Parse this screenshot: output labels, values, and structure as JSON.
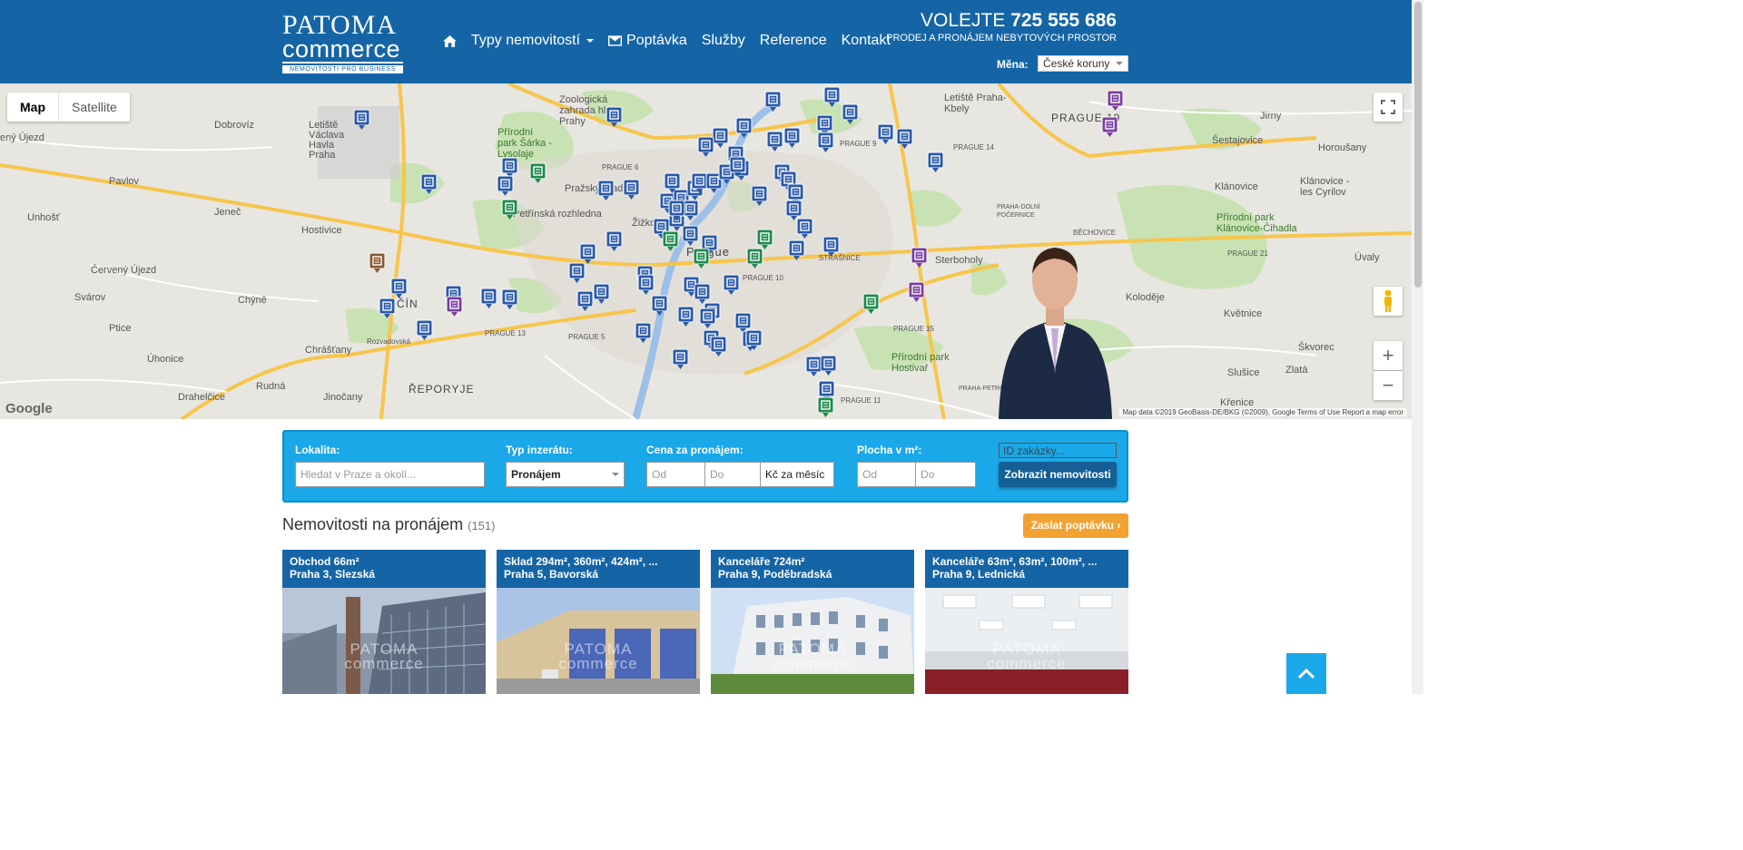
{
  "header": {
    "logo": {
      "top": "PATOMA",
      "bottom": "commerce",
      "sub": "NEMOVITOSTI PRO BUSINESS"
    },
    "nav": {
      "types": "Typy nemovitostí",
      "inquiry": "Poptávka",
      "services": "Služby",
      "references": "Reference",
      "contact": "Kontakt"
    },
    "call_prefix": "VOLEJTE",
    "phone": "725 555 686",
    "tagline": "PRODEJ A PRONÁJEM NEBYTOVÝCH PROSTOR",
    "currency_label": "Měna:",
    "currency_value": "České koruny"
  },
  "map": {
    "type_map": "Map",
    "type_satellite": "Satellite",
    "google": "Google",
    "credits": "Map data ©2019 GeoBasis-DE/BKG (©2009), Google    Terms of Use    Report a map error",
    "labels": [
      "Zoologická zahrada hl. m. Prahy",
      "Letiště Praha-Kbely",
      "PRAGUE 19",
      "Jirny",
      "Dobrovíz",
      "Letiště Václava Havla Praha",
      "Přírodní park Šárka - Lysolaje",
      "PRAGUE 6",
      "PRAGUE 9",
      "PRAGUE 14",
      "Šestajovice",
      "Horoušany",
      "Pavlov",
      "Jeneč",
      "Pražský hrad",
      "Petřínská rozhledna",
      "Žižkov",
      "Klánovice",
      "Klánovice - les Cyrilov",
      "Unhošť",
      "Hostivice",
      "Prague",
      "STRAŠNICE",
      "Přírodní park Klánovice-Čihadla",
      "Červený Újezd",
      "PRAHA-DOLNÍ POČERNICE",
      "BĚCHOVICE",
      "PRAGUE 21",
      "Úvaly",
      "Svárov",
      "Chýně",
      "PRAGUE 10",
      "Sterboholy",
      "Koloděje",
      "Ptice",
      "PRAGUE 13",
      "PRAGUE 5",
      "PRAGUE 15",
      "Květnice",
      "Chrášťany",
      "Úhonice",
      "Přírodní park Hostivař",
      "Škvorec",
      "Slušice",
      "Zlatá",
      "Rudná",
      "ŘEPORYJE",
      "PRAGUE 11",
      "PRAHA-PETROVICE",
      "Křenice",
      "Drahelčice",
      "Jinočany",
      "ený Újezd",
      "Rozvadovská",
      "ČÍN"
    ]
  },
  "search": {
    "location_label": "Lokalita:",
    "location_placeholder": "Hledat v Praze a okolí...",
    "type_label": "Typ inzerátu:",
    "type_value": "Pronájem",
    "price_label": "Cena za pronájem:",
    "price_from": "Od",
    "price_to": "Do",
    "price_unit": "Kč za měsíc",
    "area_label": "Plocha v m²:",
    "area_from": "Od",
    "area_to": "Do",
    "id_placeholder": "ID zakázky...",
    "submit": "Zobrazit nemovitosti"
  },
  "listing": {
    "title": "Nemovitosti na pronájem",
    "count": "(151)",
    "inquiry_button": "Zaslat poptávku",
    "cards": [
      {
        "title": "Obchod 66m²",
        "location": "Praha 3, Slezská",
        "watermark_top": "PATOMA",
        "watermark_bottom": "commerce"
      },
      {
        "title": "Sklad 294m², 360m², 424m², ...",
        "location": "Praha 5, Bavorská",
        "watermark_top": "PATOMA",
        "watermark_bottom": "commerce"
      },
      {
        "title": "Kanceláře 724m²",
        "location": "Praha 9, Poděbradská",
        "watermark_top": "PATOMA",
        "watermark_bottom": "commerce"
      },
      {
        "title": "Kanceláře 63m², 63m², 100m², ...",
        "location": "Praha 9, Lednická",
        "watermark_top": "PATOMA",
        "watermark_bottom": "commerce"
      }
    ]
  },
  "colors": {
    "brand": "#1565a6",
    "search": "#1ba8e8",
    "accent": "#f2a233",
    "pin_office": "#2a5aa8",
    "pin_shop": "#1f8a4c",
    "pin_purple": "#7a3fa0"
  }
}
